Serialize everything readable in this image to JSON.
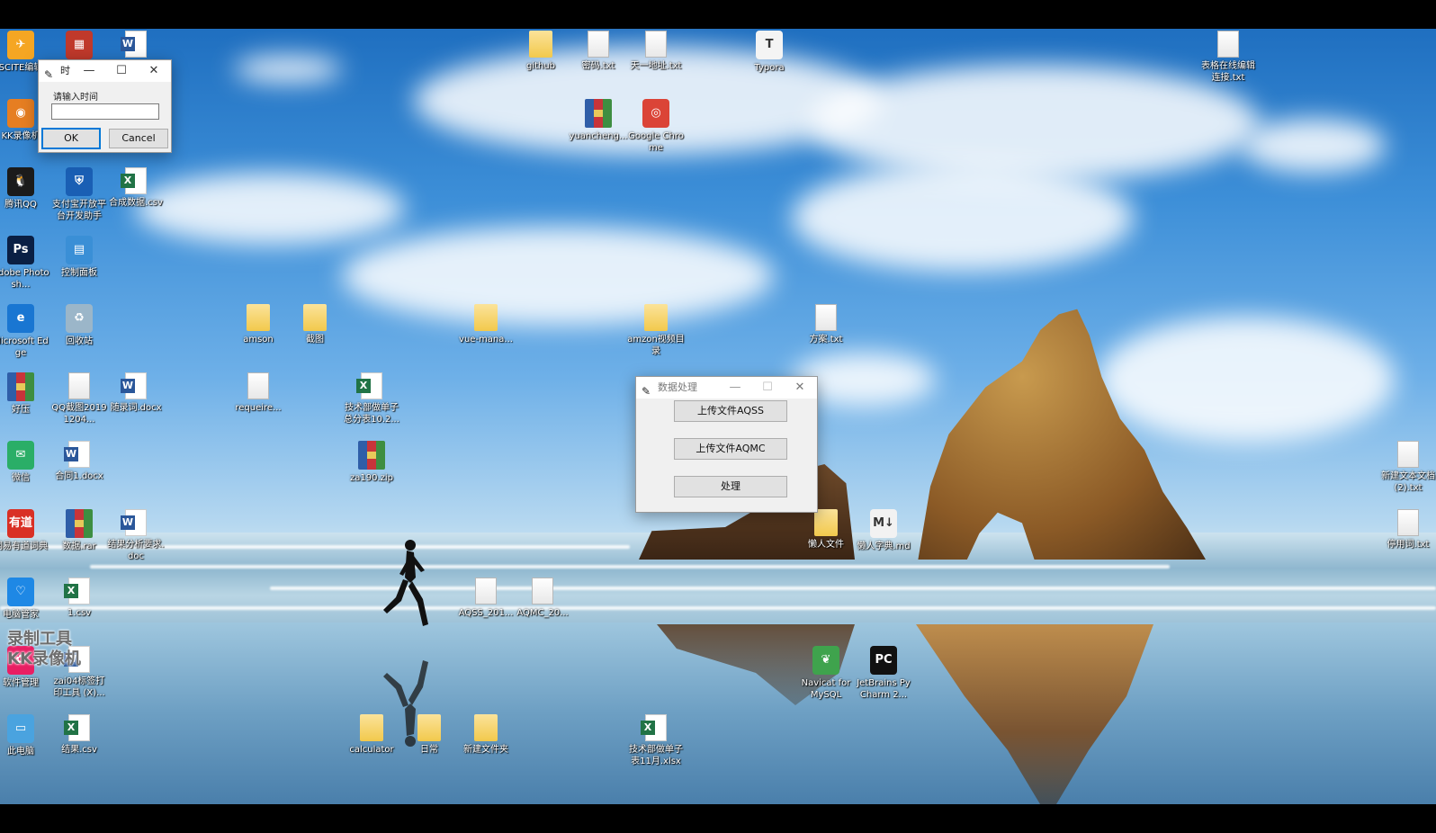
{
  "desktop": {
    "icons": [
      {
        "label": "SCITE编辑",
        "kind": "app",
        "color": "#f5a623",
        "glyph": "✈",
        "icon": "scite-icon"
      },
      {
        "label": "",
        "kind": "app",
        "color": "#c0392b",
        "glyph": "▦",
        "icon": "redbox-app-icon"
      },
      {
        "label": "",
        "kind": "word",
        "icon": "word-document-icon"
      },
      {
        "label": "KK录像机",
        "kind": "app",
        "color": "#e67e22",
        "glyph": "◉",
        "icon": "kk-recorder-icon"
      },
      {
        "label": "腾讯QQ",
        "kind": "app",
        "color": "#1b1b1b",
        "glyph": "🐧",
        "icon": "qq-penguin-icon"
      },
      {
        "label": "支付宝开放平台开发助手",
        "kind": "app",
        "color": "#1a5fb4",
        "glyph": "⛨",
        "icon": "alipay-devtool-icon"
      },
      {
        "label": "合成数据.csv",
        "kind": "excel",
        "icon": "csv-file-icon"
      },
      {
        "label": "Adobe Photosh...",
        "kind": "app",
        "color": "#0a1f44",
        "glyph": "Ps",
        "icon": "photoshop-icon"
      },
      {
        "label": "控制面板",
        "kind": "app",
        "color": "#3a8fd6",
        "glyph": "▤",
        "icon": "control-panel-icon"
      },
      {
        "label": "Microsoft Edge",
        "kind": "app",
        "color": "#1976d2",
        "glyph": "e",
        "icon": "edge-icon"
      },
      {
        "label": "回收站",
        "kind": "app",
        "color": "#9bb6c9",
        "glyph": "♻",
        "icon": "recycle-bin-icon"
      },
      {
        "label": "好压",
        "kind": "rar",
        "icon": "haozip-icon"
      },
      {
        "label": "QQ截图20191204...",
        "kind": "file",
        "icon": "image-file-icon"
      },
      {
        "label": "随录词.docx",
        "kind": "word",
        "icon": "word-document-icon"
      },
      {
        "label": "微信",
        "kind": "app",
        "color": "#2aae67",
        "glyph": "✉",
        "icon": "wechat-icon"
      },
      {
        "label": "合同1.docx",
        "kind": "word",
        "icon": "word-document-icon"
      },
      {
        "label": "网易有道词典",
        "kind": "app",
        "color": "#d93025",
        "glyph": "有道",
        "icon": "youdao-dict-icon"
      },
      {
        "label": "数据.rar",
        "kind": "rar",
        "icon": "rar-archive-icon"
      },
      {
        "label": "结果分析要求.doc",
        "kind": "word",
        "icon": "word-document-icon"
      },
      {
        "label": "电脑管家",
        "kind": "app",
        "color": "#1e88e5",
        "glyph": "♡",
        "icon": "pc-manager-icon"
      },
      {
        "label": "1.csv",
        "kind": "excel",
        "icon": "csv-file-icon"
      },
      {
        "label": "软件管理",
        "kind": "app",
        "color": "#e91e63",
        "glyph": "✿",
        "icon": "software-manager-icon"
      },
      {
        "label": "zai04标签打印工具 (X)...",
        "kind": "word",
        "icon": "word-document-icon"
      },
      {
        "label": "此电脑",
        "kind": "app",
        "color": "#4aa3df",
        "glyph": "▭",
        "icon": "this-pc-icon"
      },
      {
        "label": "结果.csv",
        "kind": "excel",
        "icon": "csv-file-icon"
      },
      {
        "label": "github",
        "kind": "folder",
        "icon": "folder-icon"
      },
      {
        "label": "密码.txt",
        "kind": "file",
        "icon": "text-file-icon"
      },
      {
        "label": "天一地址.txt",
        "kind": "file",
        "icon": "text-file-icon"
      },
      {
        "label": "Typora",
        "kind": "app",
        "color": "#f4f4f4",
        "glyph": "T",
        "icon": "typora-icon"
      },
      {
        "label": "yuancheng...",
        "kind": "rar",
        "icon": "rar-archive-icon"
      },
      {
        "label": "Google Chrome",
        "kind": "app",
        "color": "#db4437",
        "glyph": "◎",
        "icon": "chrome-icon"
      },
      {
        "label": "表格在线编辑连接.txt",
        "kind": "file",
        "icon": "text-file-icon"
      },
      {
        "label": "amson",
        "kind": "folder",
        "icon": "folder-icon"
      },
      {
        "label": "截图",
        "kind": "folder",
        "icon": "folder-icon"
      },
      {
        "label": "vue-mana...",
        "kind": "folder",
        "icon": "folder-icon"
      },
      {
        "label": "amzon视频目录",
        "kind": "folder",
        "icon": "folder-icon"
      },
      {
        "label": "方案.txt",
        "kind": "file",
        "icon": "text-file-icon"
      },
      {
        "label": "requeire...",
        "kind": "file",
        "icon": "text-file-icon"
      },
      {
        "label": "技术部做单子总分表10.2...",
        "kind": "excel",
        "icon": "xlsx-file-icon"
      },
      {
        "label": "za190.zip",
        "kind": "rar",
        "icon": "zip-archive-icon"
      },
      {
        "label": "AQSS_201...",
        "kind": "file",
        "icon": "data-file-icon"
      },
      {
        "label": "AQMC_20...",
        "kind": "file",
        "icon": "data-file-icon"
      },
      {
        "label": "懒人文件",
        "kind": "folder",
        "icon": "folder-icon"
      },
      {
        "label": "懒人字典.md",
        "kind": "app",
        "color": "#f2f2f2",
        "glyph": "M↓",
        "icon": "markdown-file-icon"
      },
      {
        "label": "Navicat for MySQL",
        "kind": "app",
        "color": "#3fa34d",
        "glyph": "❦",
        "icon": "navicat-icon"
      },
      {
        "label": "JetBrains PyCharm 2...",
        "kind": "app",
        "color": "#111111",
        "glyph": "PC",
        "icon": "pycharm-icon"
      },
      {
        "label": "calculator",
        "kind": "folder",
        "icon": "folder-icon"
      },
      {
        "label": "日常",
        "kind": "folder",
        "icon": "folder-icon"
      },
      {
        "label": "新建文件夹",
        "kind": "folder",
        "icon": "folder-icon"
      },
      {
        "label": "技术部做单子表11月.xlsx",
        "kind": "excel",
        "icon": "xlsx-file-icon"
      },
      {
        "label": "新建文本文档 (2).txt",
        "kind": "file",
        "icon": "text-file-icon"
      },
      {
        "label": "停用词.txt",
        "kind": "file",
        "icon": "text-file-icon"
      }
    ],
    "watermark": {
      "line1": "录制工具",
      "line2": "KK录像机"
    }
  },
  "input_dialog": {
    "title": "时",
    "prompt": "请输入时间",
    "value": "",
    "ok_label": "OK",
    "cancel_label": "Cancel",
    "minimize_glyph": "—",
    "maximize_glyph": "☐",
    "close_glyph": "✕"
  },
  "data_dialog": {
    "title": "数据处理",
    "upload_aqss_label": "上传文件AQSS",
    "upload_aqmc_label": "上传文件AQMC",
    "process_label": "处理",
    "minimize_glyph": "—",
    "maximize_glyph": "☐",
    "close_glyph": "✕"
  }
}
